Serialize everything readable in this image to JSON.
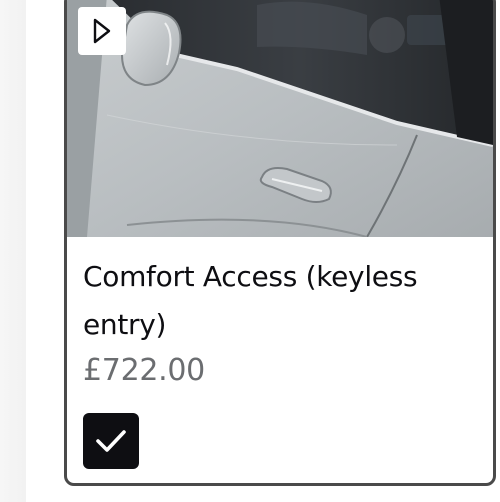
{
  "card": {
    "title": "Comfort Access (keyless entry)",
    "price": "£722.00",
    "selected": true,
    "image_subject": "car-door-handle",
    "icons": {
      "play": "play-icon",
      "check": "checkmark-icon"
    },
    "colors": {
      "border": "#4a4a4a",
      "checkbox_fill": "#0e0e12",
      "price_text": "#6b6d70",
      "title_text": "#0e0e12"
    }
  }
}
